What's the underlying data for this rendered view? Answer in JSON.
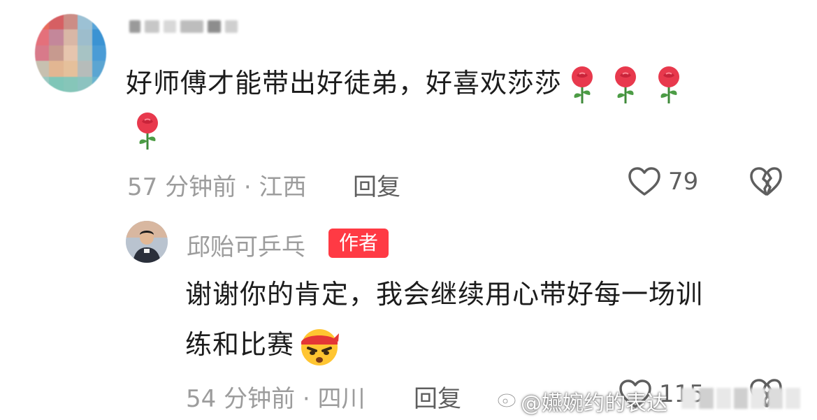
{
  "top_comment": {
    "text": "好师傅才能带出好徒弟，好喜欢莎莎",
    "time_location": "57 分钟前 · 江西",
    "reply_label": "回复",
    "like_count": "79",
    "emoji": "rose-emoji"
  },
  "author_reply": {
    "author_name": "邱贻可乒乓",
    "badge": "作者",
    "text_line1": "谢谢你的肯定，我会继续用心带好每一场训",
    "text_line2": "练和比赛",
    "time_location": "54 分钟前 · 四川",
    "reply_label": "回复",
    "like_count": "115",
    "emoji": "determined-face-emoji"
  },
  "watermark": {
    "text": "@嬿婉约的表达"
  },
  "colors": {
    "badge": "#ff3a44",
    "meta": "#9c9c9c",
    "text": "#1c1c1c"
  }
}
